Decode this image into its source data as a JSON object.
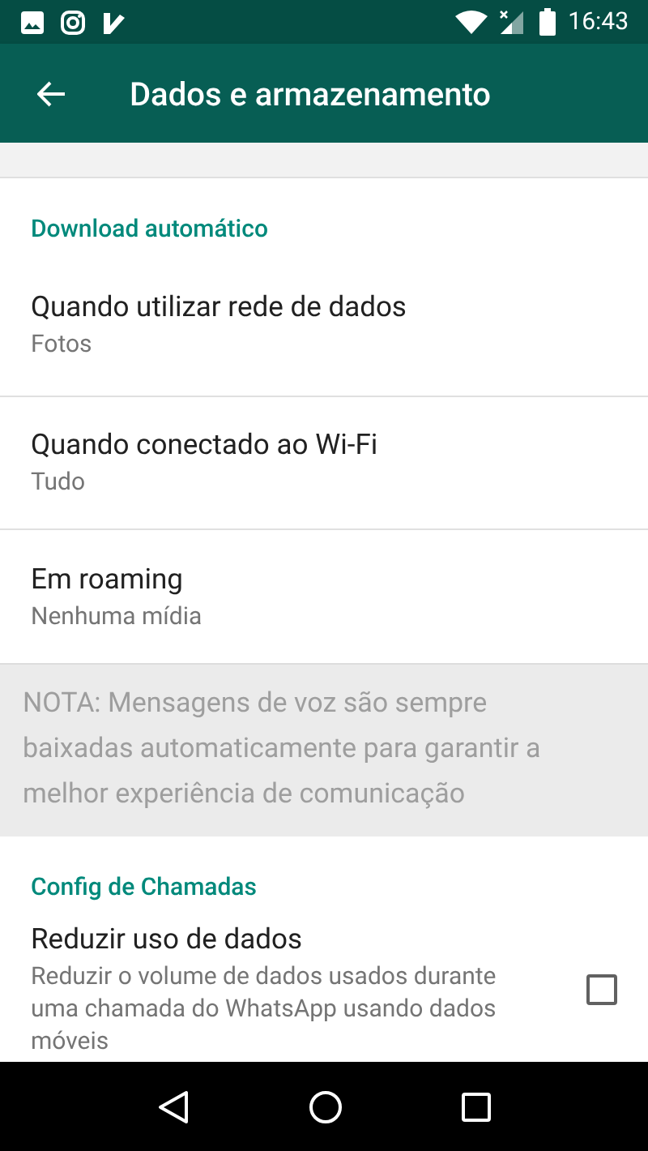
{
  "status_bar": {
    "time": "16:43"
  },
  "app_bar": {
    "title": "Dados e armazenamento"
  },
  "sections": [
    {
      "kind": "settings",
      "header": "Download automático",
      "items": [
        {
          "kind": "option",
          "title": "Quando utilizar rede de dados",
          "subtitle": "Fotos"
        },
        {
          "kind": "option",
          "title": "Quando conectado ao Wi-Fi",
          "subtitle": "Tudo"
        },
        {
          "kind": "option",
          "title": "Em roaming",
          "subtitle": "Nenhuma mídia"
        }
      ]
    },
    {
      "kind": "note",
      "text": "NOTA: Mensagens de voz são sempre baixadas automaticamente para garantir a melhor experiência de comunicação"
    },
    {
      "kind": "settings",
      "header": "Config de Chamadas",
      "items": [
        {
          "kind": "checkbox",
          "title": "Reduzir uso de dados",
          "subtitle": "Reduzir o volume de dados usados durante uma chamada do WhatsApp usando dados móveis",
          "checked": false
        }
      ]
    }
  ]
}
